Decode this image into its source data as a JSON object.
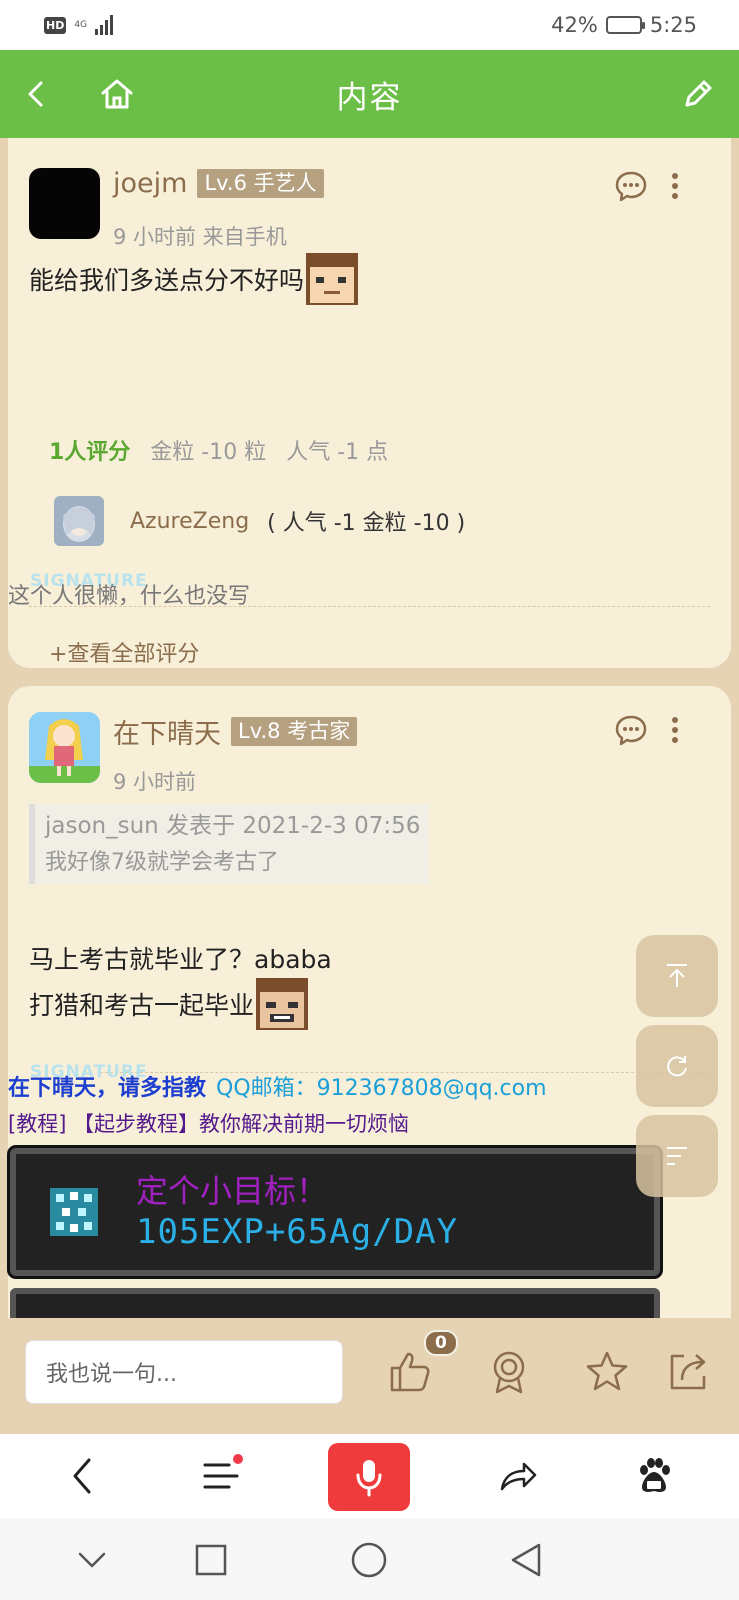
{
  "status_bar": {
    "network": "4G",
    "battery_percent": "42%",
    "battery_level": 0.42,
    "time": "5:25"
  },
  "header": {
    "title": "内容"
  },
  "posts": [
    {
      "username": "joejm",
      "level": "Lv.6 手艺人",
      "time": "9 小时前 来自手机",
      "text": "能给我们多送点分不好吗",
      "rating_summary": {
        "count": "1人评分",
        "gold": "金粒 -10 粒",
        "popularity": "人气 -1 点"
      },
      "ratings": [
        {
          "user": "AzureZeng",
          "detail": "( 人气 -1 金粒 -10 )"
        }
      ],
      "view_all": "+查看全部评分",
      "signature": "这个人很懒，什么也没写"
    },
    {
      "username": "在下晴天",
      "level": "Lv.8 考古家",
      "time": "9 小时前",
      "quote_header": "jason_sun 发表于 2021-2-3 07:56",
      "quote_text": "我好像7级就学会考古了",
      "line1": "马上考古就毕业了？ababa",
      "line2": "打猎和考古一起毕业",
      "sig_bold": "在下晴天，请多指教",
      "sig_email": "QQ邮箱：912367808@qq.com",
      "sig_tutorial": "[教程] 【起步教程】教你解决前期一切烦恼",
      "banner_line1": "定个小目标！",
      "banner_line2": "105EXP+65Ag/DAY"
    }
  ],
  "signature_mark": "SIGNATURE",
  "reply": {
    "placeholder": "我也说一句...",
    "like_count": "0"
  },
  "colors": {
    "header_green": "#6cbf46",
    "page_bg": "#e6d3b3",
    "card_bg": "#f8efd9",
    "accent_brown": "#8b6d4b",
    "mic_red": "#ef3b3b"
  }
}
